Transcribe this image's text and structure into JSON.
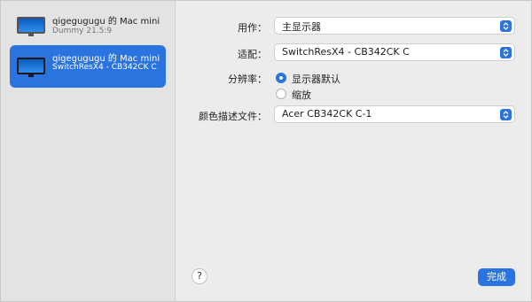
{
  "sidebar": {
    "displays": [
      {
        "name": "qigegugugu 的 Mac mini",
        "detail": "Dummy 21.5:9",
        "selected": false,
        "icon": "monitor-icon"
      },
      {
        "name": "qigegugugu 的 Mac mini",
        "detail": "SwitchResX4 - CB342CK C",
        "selected": true,
        "icon": "monitor-icon"
      }
    ]
  },
  "settings": {
    "use_as": {
      "label": "用作：",
      "value": "主显示器"
    },
    "optimize_for": {
      "label": "适配：",
      "value": "SwitchResX4 - CB342CK C"
    },
    "resolution": {
      "label": "分辨率：",
      "options": [
        {
          "label": "显示器默认",
          "selected": true
        },
        {
          "label": "缩放",
          "selected": false
        }
      ]
    },
    "color_profile": {
      "label": "颜色描述文件：",
      "value": "Acer CB342CK C-1"
    }
  },
  "footer": {
    "help_label": "?",
    "done_label": "完成"
  },
  "colors": {
    "accent": "#2b74e0",
    "sidebar_bg": "#e3e3e3",
    "window_bg": "#ececec"
  }
}
